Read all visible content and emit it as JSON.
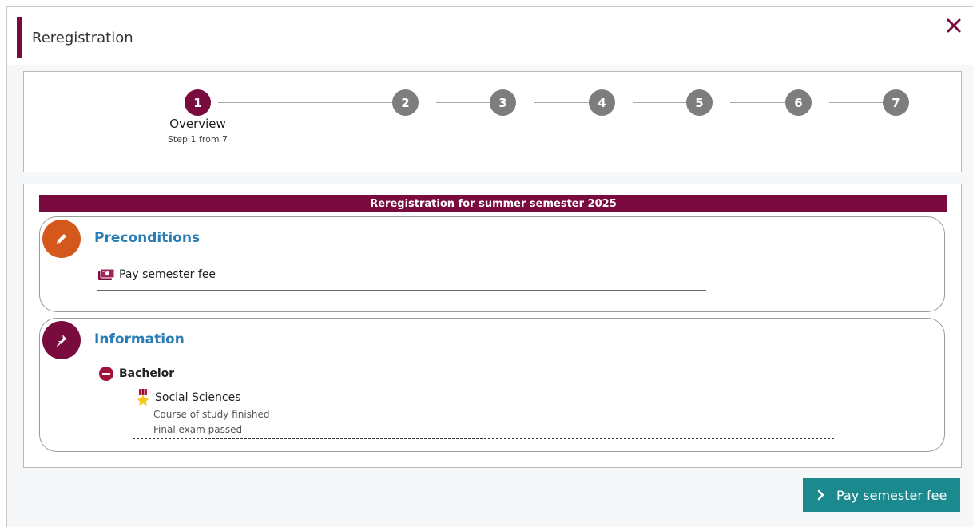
{
  "dialog": {
    "title": "Reregistration",
    "close_icon": "close-icon"
  },
  "stepper": {
    "steps": [
      "1",
      "2",
      "3",
      "4",
      "5",
      "6",
      "7"
    ],
    "active_step": 1,
    "active_title": "Overview",
    "active_subtitle": "Step 1 from 7"
  },
  "content": {
    "banner": "Reregistration for summer semester 2025",
    "preconditions": {
      "heading": "Preconditions",
      "icon": "pencil-icon",
      "item_label": "Pay semester fee",
      "item_icon": "money-icon"
    },
    "information": {
      "heading": "Information",
      "icon": "pin-icon",
      "degree": "Bachelor",
      "degree_icon": "collapse-minus-icon",
      "subject": "Social Sciences",
      "subject_icon": "medal-icon",
      "status_lines": [
        "Course of study finished",
        "Final exam passed"
      ]
    }
  },
  "footer": {
    "pay_button_label": "Pay semester fee",
    "pay_button_icon": "chevron-right-icon"
  },
  "colors": {
    "accent": "#7a0b3e",
    "link": "#2a7cb5",
    "button": "#1b8a8f",
    "preconditions_icon": "#d4581c",
    "step_inactive": "#7d7d7d"
  }
}
